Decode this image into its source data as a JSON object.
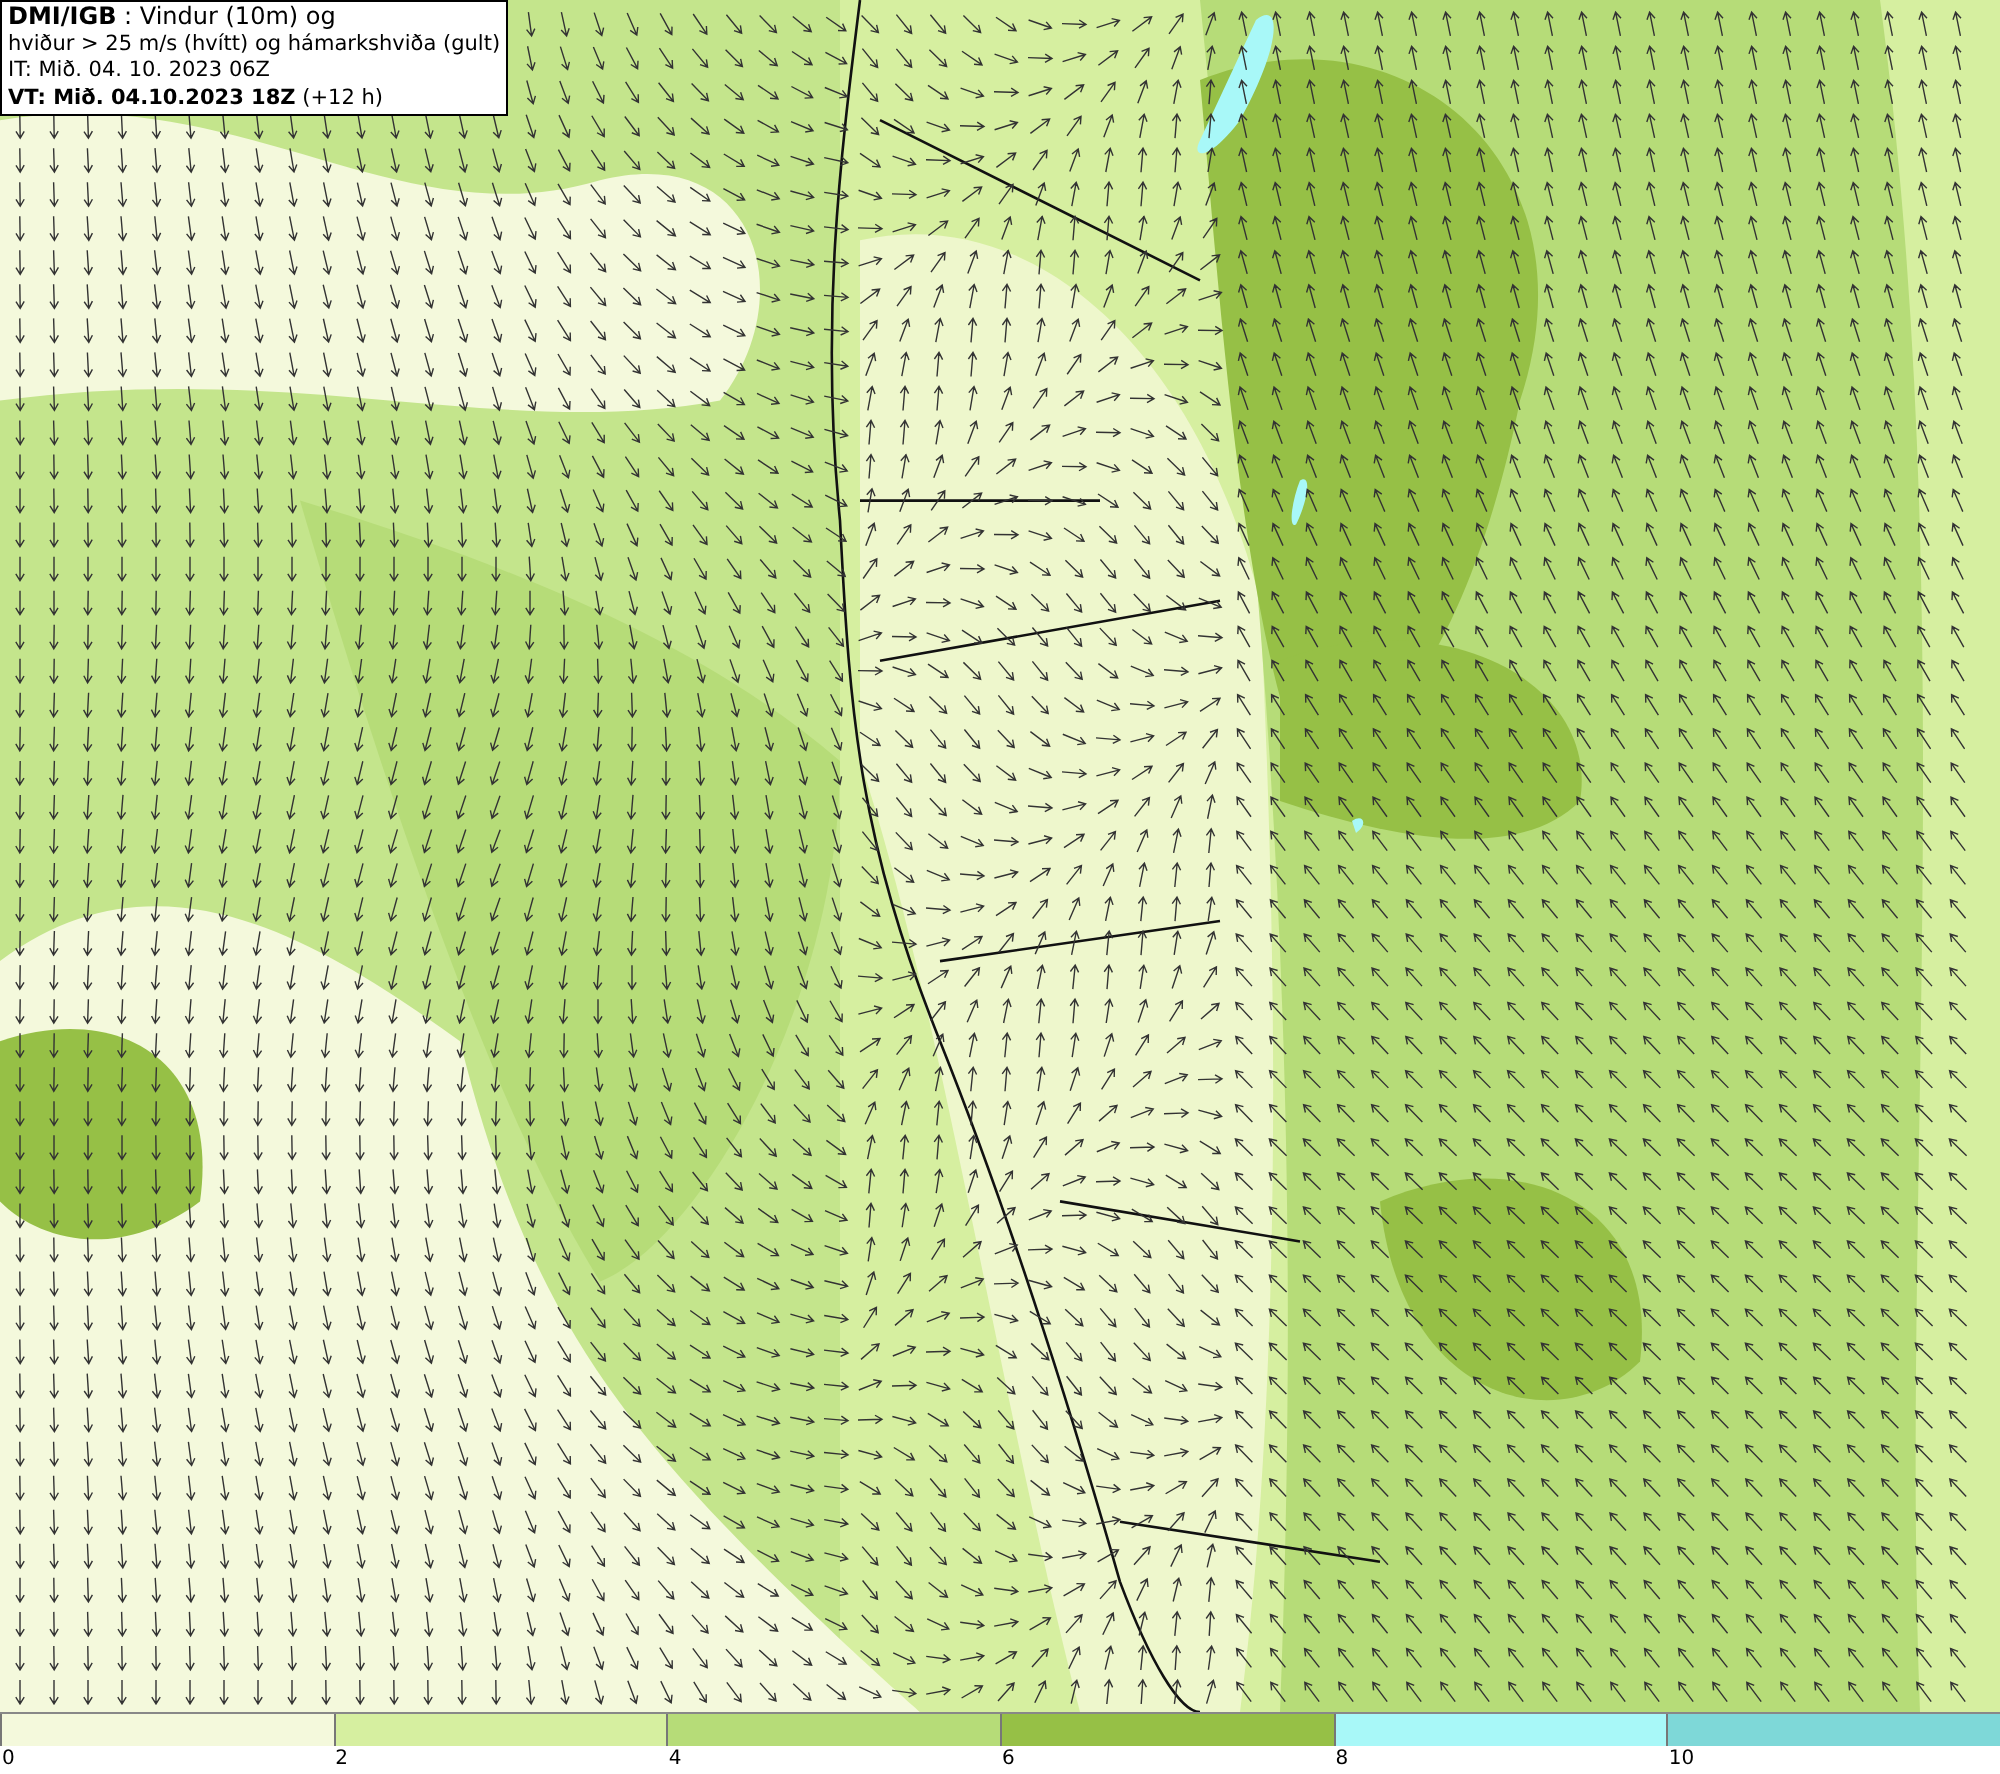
{
  "title_box": {
    "lines": [
      "**DMI/IGB** : Vindur (10m) og",
      "hviður > 25 m/s (hvítt) og hámarkshviða (gult)",
      "IT: Mið. 04. 10. 2023 06Z",
      "**VT: Mið. 04.10.2023 18Z** (+12 h)"
    ]
  },
  "legend": {
    "segments": [
      {
        "color": "#f4f9dc"
      },
      {
        "color": "#d6efa0"
      },
      {
        "color": "#b6dc78"
      },
      {
        "color": "#96c046"
      },
      {
        "color": "#a8f8f8"
      },
      {
        "color": "#7ed8d8"
      }
    ],
    "ticks": [
      "0",
      "2",
      "4",
      "6",
      "8",
      "10"
    ]
  }
}
